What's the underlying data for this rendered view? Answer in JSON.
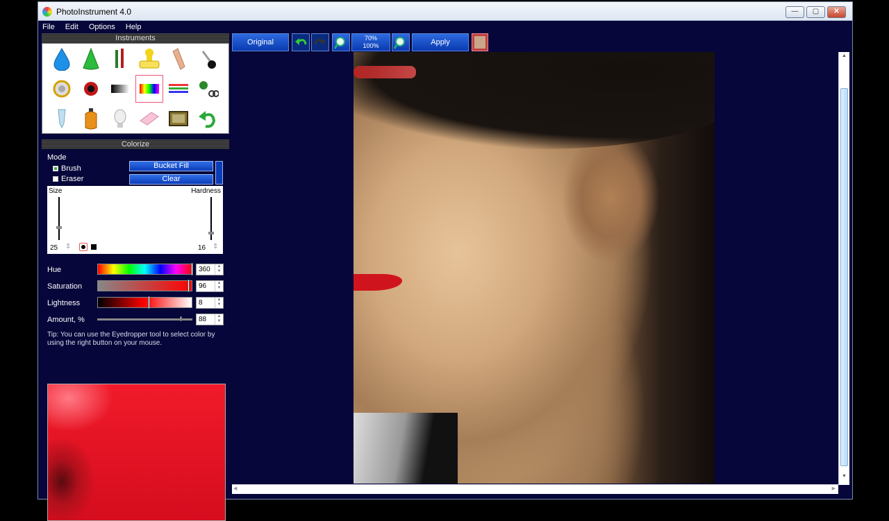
{
  "window": {
    "title": "PhotoInstrument 4.0"
  },
  "menu": {
    "items": [
      "File",
      "Edit",
      "Options",
      "Help"
    ]
  },
  "instruments": {
    "header": "Instruments"
  },
  "colorize": {
    "header": "Colorize",
    "mode_label": "Mode",
    "brush_label": "Brush",
    "eraser_label": "Eraser",
    "bucket_fill_label": "Bucket Fill",
    "clear_label": "Clear",
    "size_label": "Size",
    "hardness_label": "Hardness",
    "size_value": "25",
    "hardness_value": "16",
    "hue_label": "Hue",
    "hue_value": "360",
    "saturation_label": "Saturation",
    "saturation_value": "96",
    "lightness_label": "Lightness",
    "lightness_value": "8",
    "amount_label": "Amount, %",
    "amount_value": "88",
    "tip": "Tip: You can use the Eyedropper tool to select color by using the right button on your mouse.",
    "hue_fraction": 1.0,
    "saturation_fraction": 0.96,
    "lightness_fraction": 0.54,
    "amount_fraction": 0.88,
    "selected_color": "#e8101f"
  },
  "toolbar": {
    "original_label": "Original",
    "zoom_top": "70%",
    "zoom_bottom": "100%",
    "apply_label": "Apply"
  },
  "colors": {
    "accent": "#0b3db8",
    "background": "#06063a",
    "selected": "#e55a77"
  }
}
